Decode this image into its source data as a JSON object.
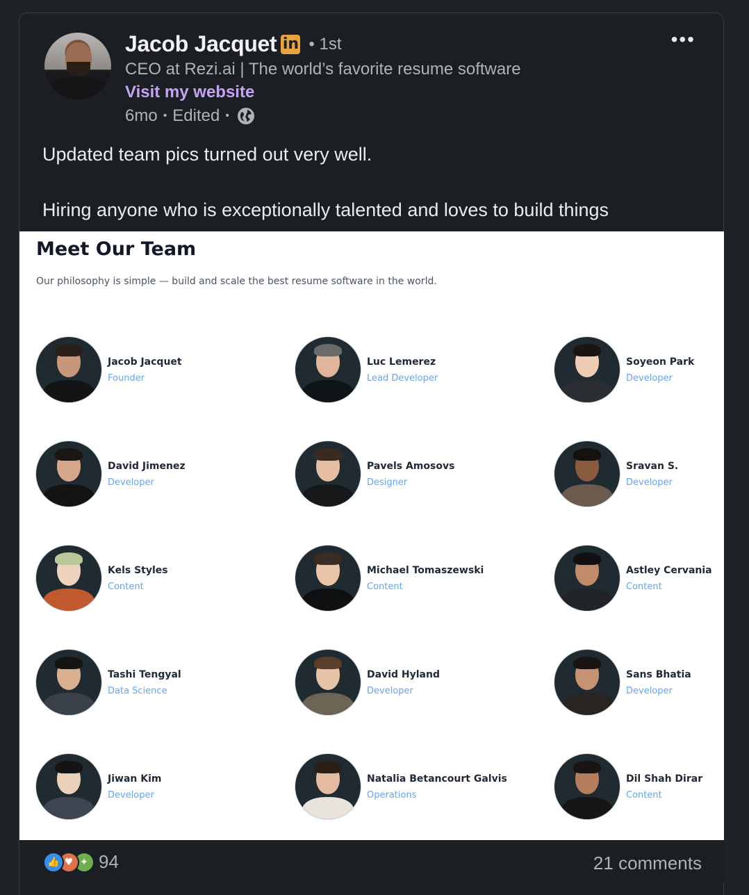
{
  "post": {
    "author_name": "Jacob Jacquet",
    "linkedin_badge": "in",
    "degree": "• 1st",
    "headline": "CEO at Rezi.ai | The world’s favorite resume software",
    "website_link": "Visit my website",
    "time": "6mo",
    "sep1": "•",
    "edited": "Edited",
    "sep2": "•",
    "visibility_icon": "globe-icon",
    "more_label": "•••",
    "text_line1": "Updated team pics turned out very well.",
    "text_line2": "Hiring anyone who is exceptionally talented and loves to build things"
  },
  "image": {
    "title": "Meet Our Team",
    "subtitle": "Our philosophy is simple — build and scale the best resume software in the world.",
    "members": [
      {
        "name": "Jacob Jacquet",
        "role": "Founder"
      },
      {
        "name": "Luc Lemerez",
        "role": "Lead Developer"
      },
      {
        "name": "Soyeon Park",
        "role": "Developer"
      },
      {
        "name": "David Jimenez",
        "role": "Developer"
      },
      {
        "name": "Pavels Amosovs",
        "role": "Designer"
      },
      {
        "name": "Sravan S.",
        "role": "Developer"
      },
      {
        "name": "Kels Styles",
        "role": "Content"
      },
      {
        "name": "Michael Tomaszewski",
        "role": "Content"
      },
      {
        "name": "Astley Cervania",
        "role": "Content"
      },
      {
        "name": "Tashi Tengyal",
        "role": "Data Science"
      },
      {
        "name": "David Hyland",
        "role": "Developer"
      },
      {
        "name": "Sans Bhatia",
        "role": "Developer"
      },
      {
        "name": "Jiwan Kim",
        "role": "Developer"
      },
      {
        "name": "Natalia Betancourt Galvis",
        "role": "Operations"
      },
      {
        "name": "Dil Shah Dirar",
        "role": "Content"
      }
    ]
  },
  "footer": {
    "reaction_icons": [
      "like-icon",
      "love-icon",
      "celebrate-icon"
    ],
    "reaction_count": "94",
    "comments": "21 comments"
  },
  "colors": {
    "background": "#1b1f23",
    "link": "#c6a2f5",
    "linkedin_badge": "#e7a33e",
    "role": "#60a5fa"
  }
}
